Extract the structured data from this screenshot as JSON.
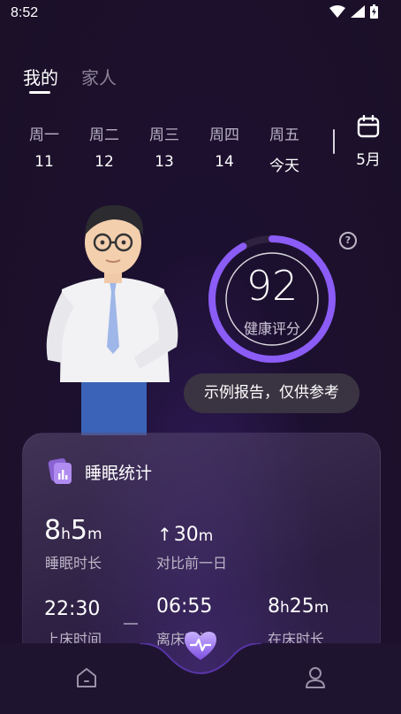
{
  "status_bar": {
    "time": "8:52"
  },
  "tabs": [
    {
      "label": "我的",
      "active": true
    },
    {
      "label": "家人",
      "active": false
    }
  ],
  "week": {
    "days": [
      {
        "dow": "周一",
        "date": "11"
      },
      {
        "dow": "周二",
        "date": "12"
      },
      {
        "dow": "周三",
        "date": "13"
      },
      {
        "dow": "周四",
        "date": "14"
      },
      {
        "dow": "周五",
        "date": "今天"
      }
    ],
    "calendar_label": "5月"
  },
  "score": {
    "value": "92",
    "label": "健康评分",
    "progress_fraction": 0.92,
    "ring_color": "#8b5cf6"
  },
  "sample_badge": "示例报告，仅供参考",
  "sleep_card": {
    "title": "睡眠统计",
    "duration": {
      "h": "8",
      "h_unit": "h",
      "m": "5",
      "m_unit": "m",
      "label": "睡眠时长"
    },
    "compare": {
      "arrow": "↑",
      "value": "30",
      "unit": "m",
      "label": "对比前一日"
    },
    "bed_time": {
      "value": "22:30",
      "label": "上床时间"
    },
    "wake_time": {
      "value": "06:55",
      "label": "离床时间"
    },
    "in_bed": {
      "h": "8",
      "h_unit": "h",
      "m": "25",
      "m_unit": "m",
      "label": "在床时长"
    }
  },
  "colors": {
    "accent": "#8b5cf6",
    "background": "#1b1027"
  },
  "nav": {
    "home_icon": "home-icon",
    "center_icon": "heart-pulse-icon",
    "profile_icon": "person-icon"
  }
}
